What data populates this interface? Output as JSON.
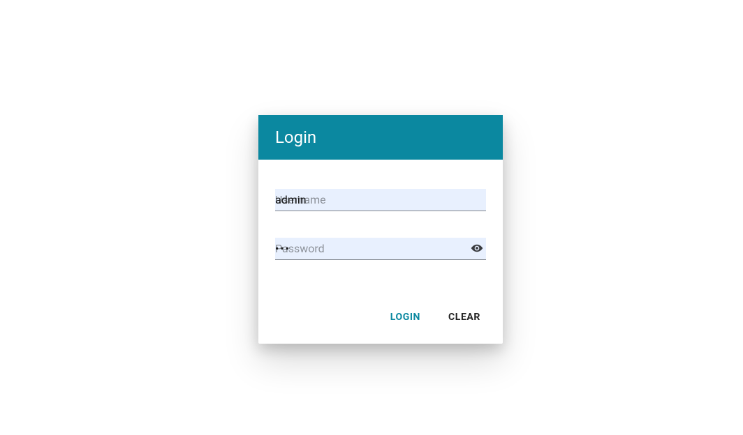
{
  "card": {
    "title": "Login"
  },
  "fields": {
    "username": {
      "label": "Username",
      "value": "admin"
    },
    "password": {
      "label": "Password",
      "value": "•••"
    }
  },
  "actions": {
    "login_label": "Login",
    "clear_label": "Clear"
  }
}
